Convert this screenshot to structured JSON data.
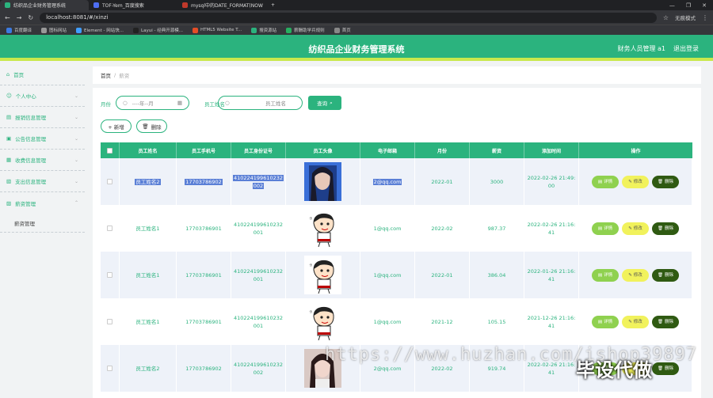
{
  "browser": {
    "tabs": [
      {
        "label": "纺织品企业财务管理系统",
        "color": "#2bb37e"
      },
      {
        "label": "TOF-Yem_百度搜索",
        "color": "#4e6ef2"
      },
      {
        "label": "mysql中的DATE_FORMAT(NOW",
        "color": "#c0392b"
      }
    ],
    "new_tab": "+",
    "url": "localhost:8081/#/xinzi",
    "profile": "无痕模式",
    "bookmarks": [
      "百度翻译",
      "图标网站",
      "Element - 网站快...",
      "Layui - 经典开源模...",
      "HTML5 Website T...",
      "搜资源站",
      "薪酬助学兵规则",
      "首页"
    ]
  },
  "header": {
    "title": "纺织品企业财务管理系统",
    "user": "财务人员管理 a1",
    "logout": "退出登录"
  },
  "sidebar": {
    "items": [
      {
        "label": "首页",
        "icon": "home-icon"
      },
      {
        "label": "个人中心",
        "icon": "user-icon"
      },
      {
        "label": "报销信息管理",
        "icon": "receipt-icon"
      },
      {
        "label": "公告信息管理",
        "icon": "notice-icon"
      },
      {
        "label": "收费信息管理",
        "icon": "income-icon"
      },
      {
        "label": "支出信息管理",
        "icon": "expense-icon"
      },
      {
        "label": "薪资管理",
        "icon": "salary-icon"
      }
    ],
    "subitem": "薪资管理"
  },
  "breadcrumb": {
    "home": "首页",
    "sep": "/",
    "current": "薪资"
  },
  "filters": {
    "month_label": "月份",
    "month_placeholder": "----年--月",
    "name_label": "员工姓名",
    "name_placeholder": "员工姓名",
    "search": "查询",
    "add": "+ 新增",
    "delete": "删除"
  },
  "table": {
    "headers": [
      "员工姓名",
      "员工手机号",
      "员工身份证号",
      "员工头像",
      "电子邮箱",
      "月份",
      "薪资",
      "添加时间",
      "操作"
    ],
    "actions": {
      "detail": "详情",
      "edit": "修改",
      "delete": "删除"
    },
    "rows": [
      {
        "name": "员工姓名2",
        "phone": "17703786902",
        "id_line1": "410224199610232",
        "id_line2": "002",
        "avatar": "girl-photo",
        "email": "2@qq.com",
        "month": "2022-01",
        "salary": "3000",
        "time_line1": "2022-02-26 21:49:",
        "time_line2": "00",
        "selected": true
      },
      {
        "name": "员工姓名1",
        "phone": "17703786901",
        "id_line1": "410224199610232",
        "id_line2": "001",
        "avatar": "cartoon",
        "email": "1@qq.com",
        "month": "2022-02",
        "salary": "987.37",
        "time_line1": "2022-02-26 21:16:",
        "time_line2": "41",
        "selected": false
      },
      {
        "name": "员工姓名1",
        "phone": "17703786901",
        "id_line1": "410224199610232",
        "id_line2": "001",
        "avatar": "cartoon",
        "email": "1@qq.com",
        "month": "2022-01",
        "salary": "386.04",
        "time_line1": "2022-01-26 21:16:",
        "time_line2": "41",
        "selected": false
      },
      {
        "name": "员工姓名1",
        "phone": "17703786901",
        "id_line1": "410224199610232",
        "id_line2": "001",
        "avatar": "cartoon",
        "email": "1@qq.com",
        "month": "2021-12",
        "salary": "105.15",
        "time_line1": "2021-12-26 21:16:",
        "time_line2": "41",
        "selected": false
      },
      {
        "name": "员工姓名2",
        "phone": "17703786902",
        "id_line1": "410224199610232",
        "id_line2": "002",
        "avatar": "girl-photo",
        "email": "2@qq.com",
        "month": "2022-02",
        "salary": "919.74",
        "time_line1": "2022-02-26 21:16:",
        "time_line2": "41",
        "selected": false
      }
    ]
  },
  "watermark": {
    "url": "https://www.huzhan.com/ishop39897",
    "brand": "毕设代做"
  }
}
